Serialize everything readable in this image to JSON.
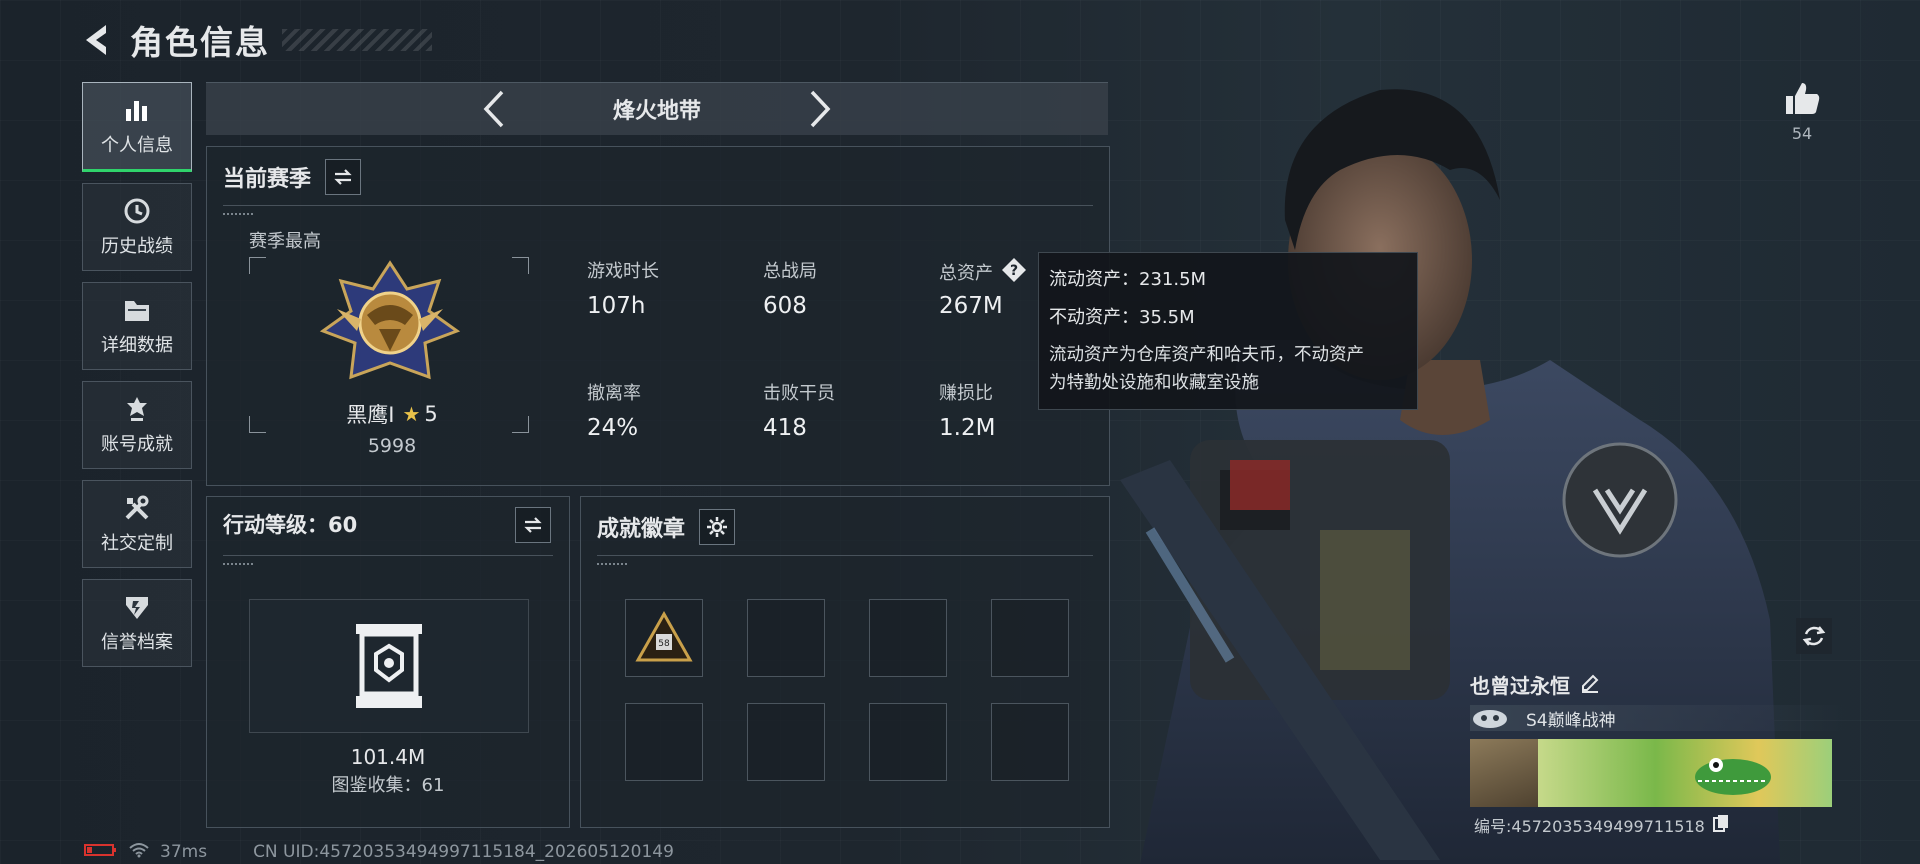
{
  "page": {
    "title": "角色信息"
  },
  "sidebar": {
    "items": [
      {
        "label": "个人信息",
        "icon": "bar-chart-icon"
      },
      {
        "label": "历史战绩",
        "icon": "history-icon"
      },
      {
        "label": "详细数据",
        "icon": "folder-icon"
      },
      {
        "label": "账号成就",
        "icon": "achievement-icon"
      },
      {
        "label": "社交定制",
        "icon": "tools-icon"
      },
      {
        "label": "信誉档案",
        "icon": "credit-icon"
      }
    ]
  },
  "mode": {
    "label": "烽火地带"
  },
  "season": {
    "title": "当前赛季",
    "best_label": "赛季最高",
    "rank_name": "黑鹰I",
    "rank_stars": "5",
    "rank_score": "5998",
    "stats": [
      {
        "label": "游戏时长",
        "value": "107h"
      },
      {
        "label": "总战局",
        "value": "608"
      },
      {
        "label": "总资产",
        "value": "267M"
      },
      {
        "label": "撤离率",
        "value": "24%"
      },
      {
        "label": "击败干员",
        "value": "418"
      },
      {
        "label": "赚损比",
        "value": "1.2M"
      }
    ]
  },
  "tooltip": {
    "line1": "流动资产：231.5M",
    "line2": "不动资产：35.5M",
    "desc1": "流动资产为仓库资产和哈夫币，不动资产",
    "desc2": "为特勤处设施和收藏室设施"
  },
  "level": {
    "title": "行动等级：60",
    "value": "101.4M",
    "collection": "图鉴收集：61"
  },
  "badges": {
    "title": "成就徽章",
    "badge_text": "58"
  },
  "profile": {
    "likes": "54",
    "name": "也曾过永恒",
    "subtitle": "S4巅峰战神",
    "id": "编号:4572035349499711518"
  },
  "status": {
    "ping": "37ms",
    "uid": "CN UID:45720353494997115184_202605120149"
  }
}
